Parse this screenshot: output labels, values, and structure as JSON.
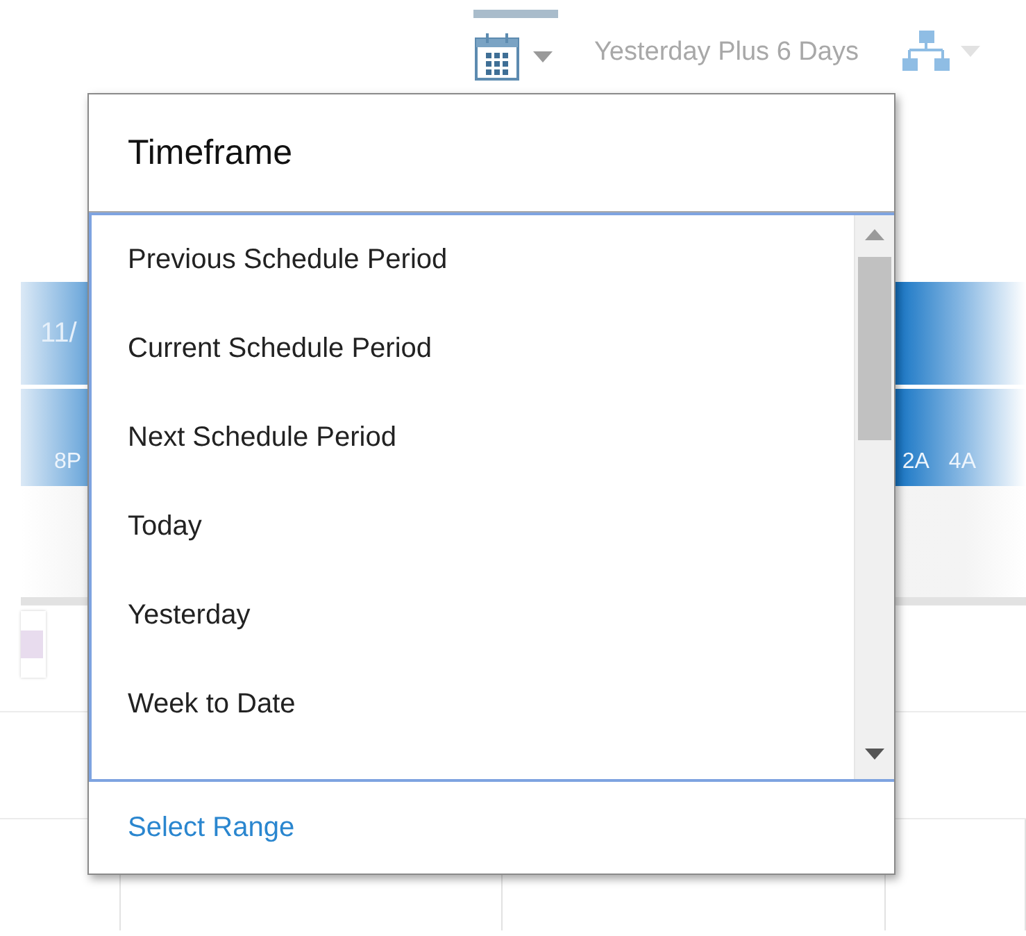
{
  "toolbar": {
    "timeframe_label": "Yesterday Plus 6 Days"
  },
  "schedule": {
    "date_header": "11/",
    "hours_left": [
      "8P"
    ],
    "hours_right": [
      "2A",
      "4A"
    ]
  },
  "popup": {
    "title": "Timeframe",
    "options": [
      {
        "label": "Previous Schedule Period"
      },
      {
        "label": "Current Schedule Period"
      },
      {
        "label": "Next Schedule Period"
      },
      {
        "label": "Today"
      },
      {
        "label": "Yesterday"
      },
      {
        "label": "Week to Date"
      }
    ],
    "footer_link": "Select Range"
  }
}
